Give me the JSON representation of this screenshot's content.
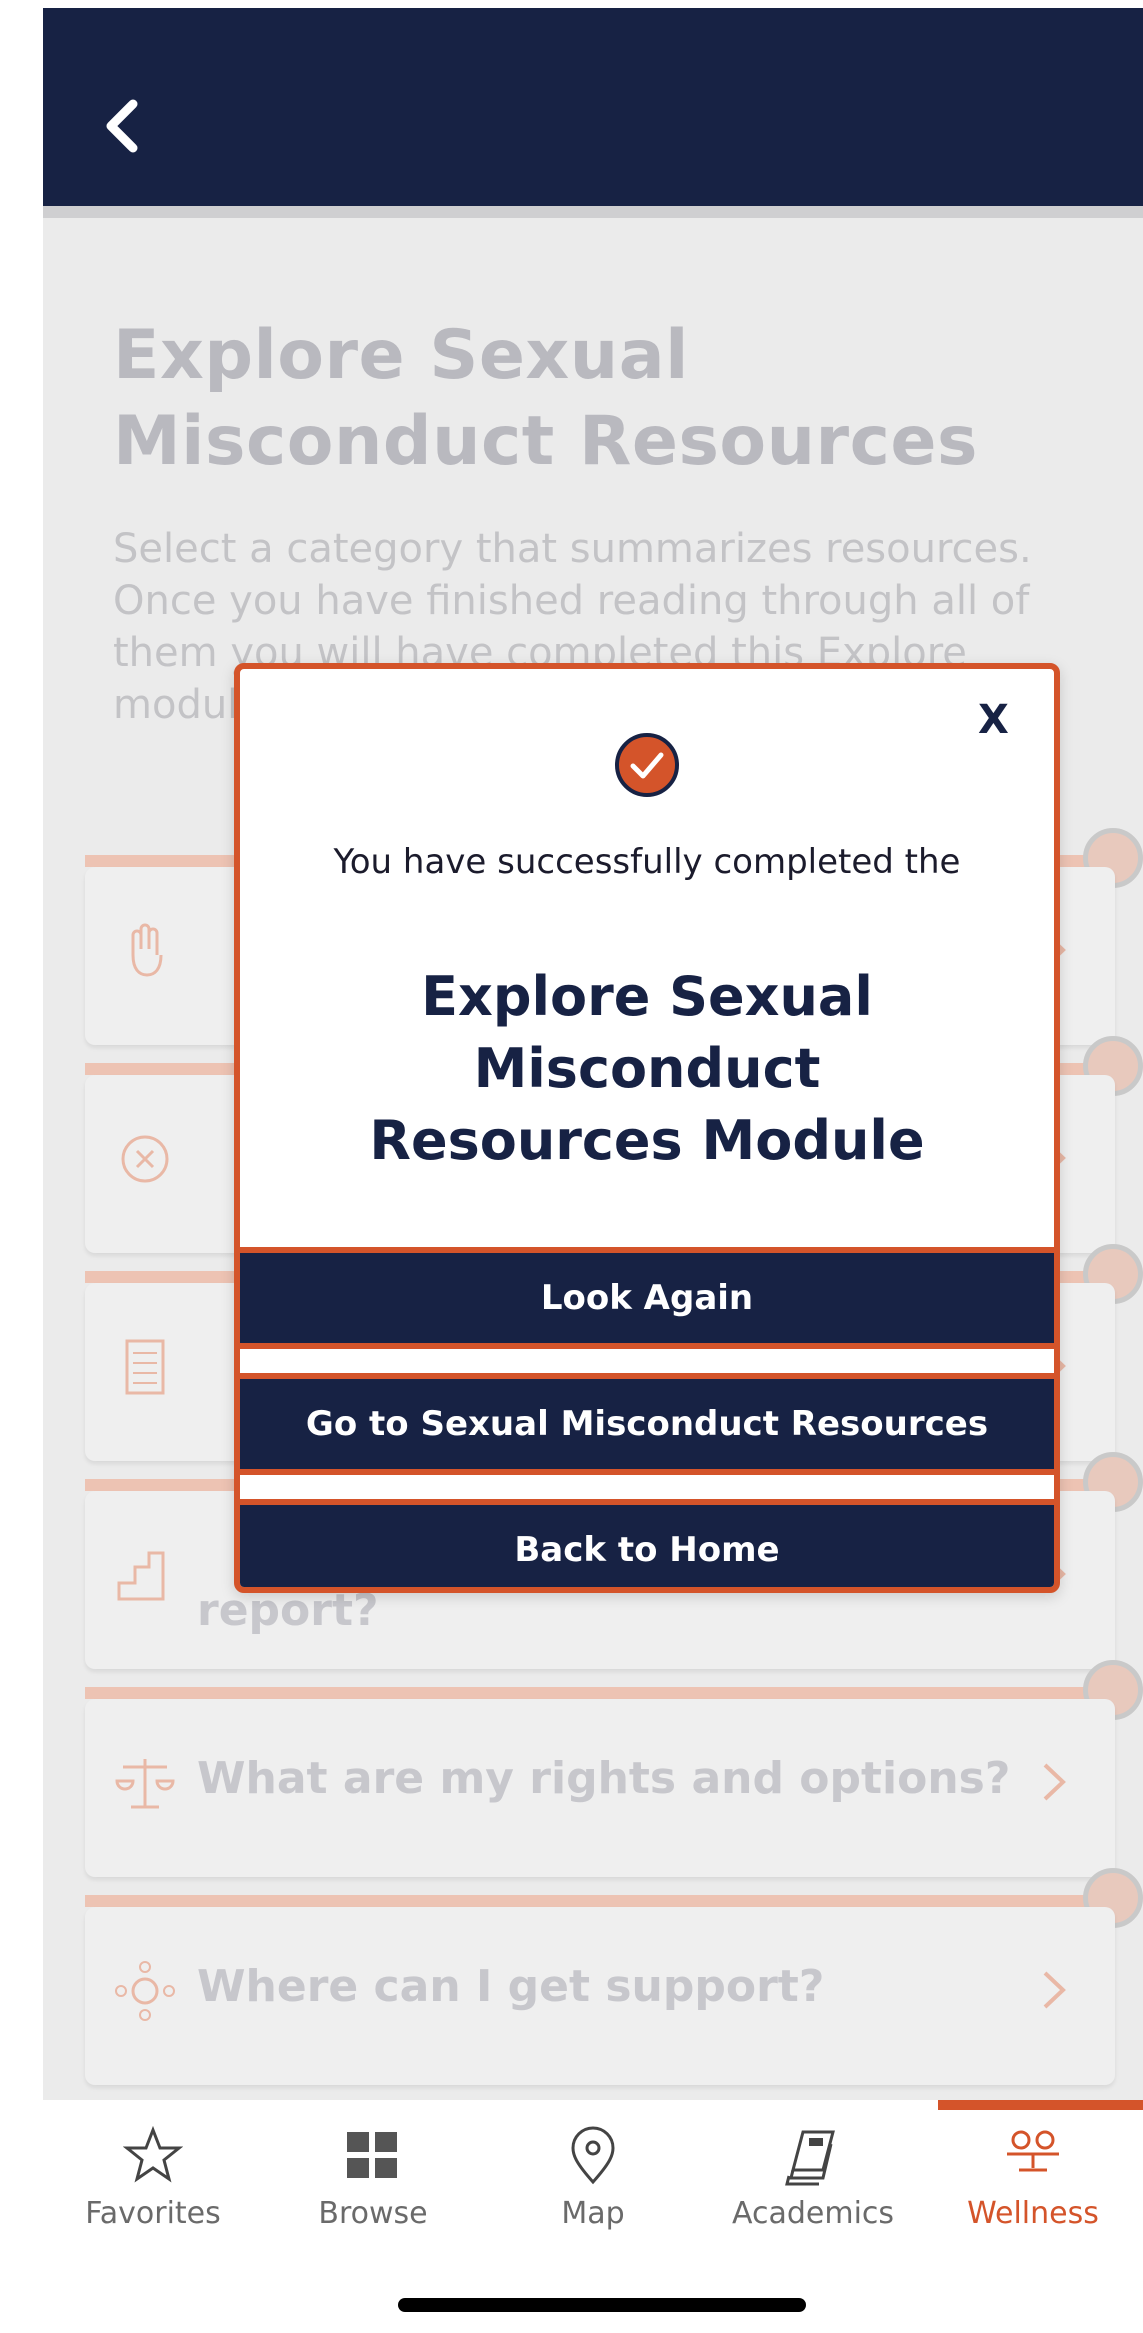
{
  "header": {
    "back_icon": "chevron-left-icon"
  },
  "page": {
    "title": "Explore Sexual Misconduct Resources",
    "subtitle": "Select a category that summarizes resources. Once you have finished reading through all of them you will have completed this Explore module."
  },
  "categories": [
    {
      "label": "",
      "icon": "raised-hand-icon"
    },
    {
      "label": "",
      "icon": "prohibited-icon"
    },
    {
      "label": "",
      "icon": "checklist-icon"
    },
    {
      "label": "report?",
      "icon": "steps-icon"
    },
    {
      "label": "What are my rights and options?",
      "icon": "scales-icon"
    },
    {
      "label": "Where can I get support?",
      "icon": "support-network-icon"
    }
  ],
  "modal": {
    "close_label": "X",
    "message": "You have successfully completed the",
    "module_title": "Explore Sexual Misconduct Resources Module",
    "buttons": {
      "look_again": "Look Again",
      "go_to_resources": "Go to Sexual Misconduct Resources",
      "back_home": "Back to Home"
    }
  },
  "tabs": [
    {
      "label": "Favorites",
      "icon": "star-icon",
      "active": false
    },
    {
      "label": "Browse",
      "icon": "grid-icon",
      "active": false
    },
    {
      "label": "Map",
      "icon": "map-pin-icon",
      "active": false
    },
    {
      "label": "Academics",
      "icon": "books-icon",
      "active": false
    },
    {
      "label": "Wellness",
      "icon": "wellness-people-icon",
      "active": true
    }
  ],
  "colors": {
    "navy": "#172244",
    "accent": "#d4542a"
  }
}
